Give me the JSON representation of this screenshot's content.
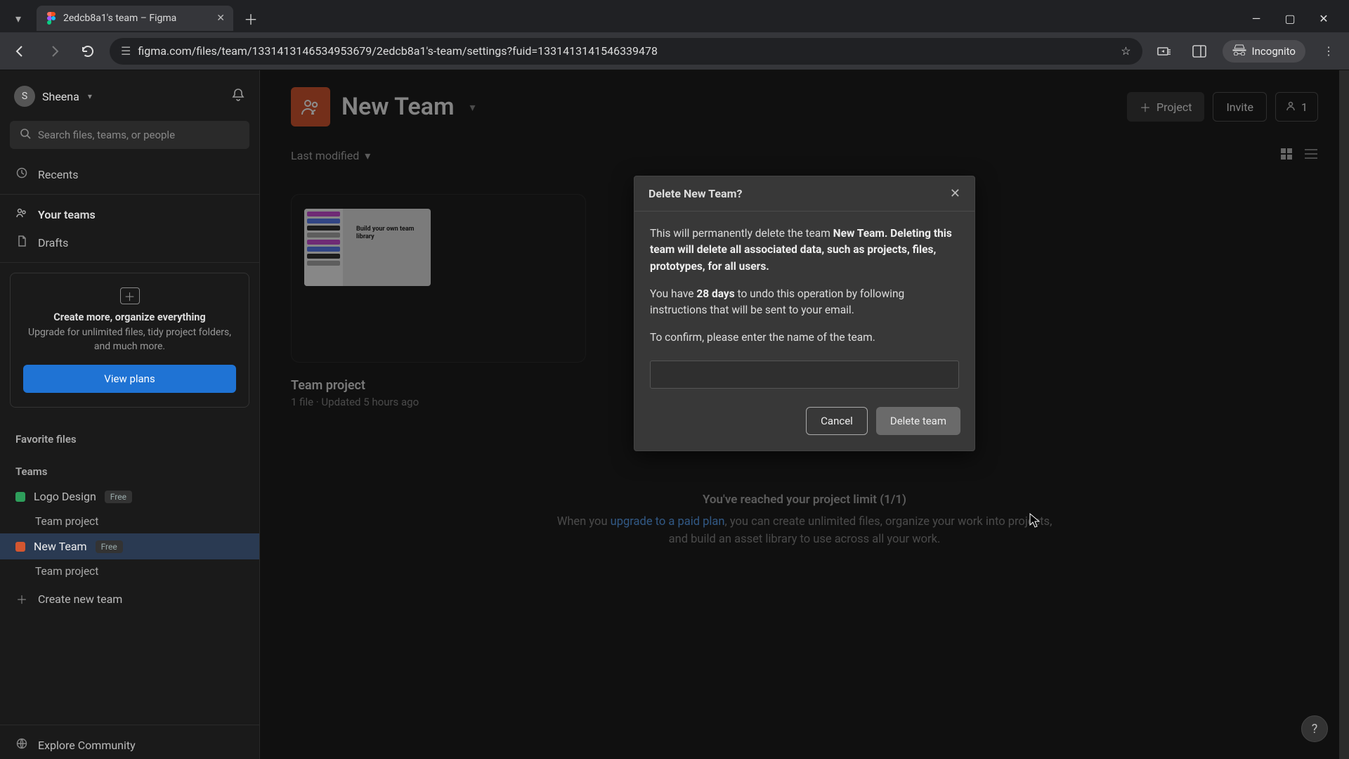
{
  "browser": {
    "tab_title": "2edcb8a1's team – Figma",
    "url": "figma.com/files/team/1331413146534953679/2edcb8a1's-team/settings?fuid=1331413141546339478",
    "incognito_label": "Incognito"
  },
  "user": {
    "initial": "S",
    "name": "Sheena"
  },
  "search": {
    "placeholder": "Search files, teams, or people"
  },
  "nav": {
    "recents": "Recents",
    "your_teams": "Your teams",
    "drafts": "Drafts",
    "favorite_files": "Favorite files",
    "teams_header": "Teams",
    "create_team": "Create new team",
    "explore": "Explore Community"
  },
  "upgrade": {
    "title": "Create more, organize everything",
    "body": "Upgrade for unlimited files, tidy project folders, and much more.",
    "button": "View plans"
  },
  "teams": [
    {
      "name": "Logo Design",
      "color": "#2e9e5b",
      "badge": "Free",
      "project": "Team project"
    },
    {
      "name": "New Team",
      "color": "#d35630",
      "badge": "Free",
      "project": "Team project"
    }
  ],
  "page": {
    "title": "New Team",
    "project_button": "Project",
    "invite_button": "Invite",
    "member_count": "1",
    "sort_label": "Last modified"
  },
  "project_card": {
    "thumb_text": "Build your own team library",
    "title": "Team project",
    "meta": "1 file · Updated 5 hours ago"
  },
  "limit": {
    "title": "You've reached your project limit (1/1)",
    "pre": "When you ",
    "link": "upgrade to a paid plan",
    "post": ", you can create unlimited files, organize your work into projects, and build an asset library to use across all your work."
  },
  "modal": {
    "title": "Delete New Team?",
    "p1_pre": "This will permanently delete the team ",
    "p1_team": "New Team",
    "p1_post": ". Deleting this team will delete all associated data, such as projects, files, prototypes, for all users.",
    "p2_pre": "You have ",
    "p2_days": "28 days",
    "p2_post": " to undo this operation by following instructions that will be sent to your email.",
    "p3": "To confirm, please enter the name of the team.",
    "cancel": "Cancel",
    "delete": "Delete team"
  }
}
